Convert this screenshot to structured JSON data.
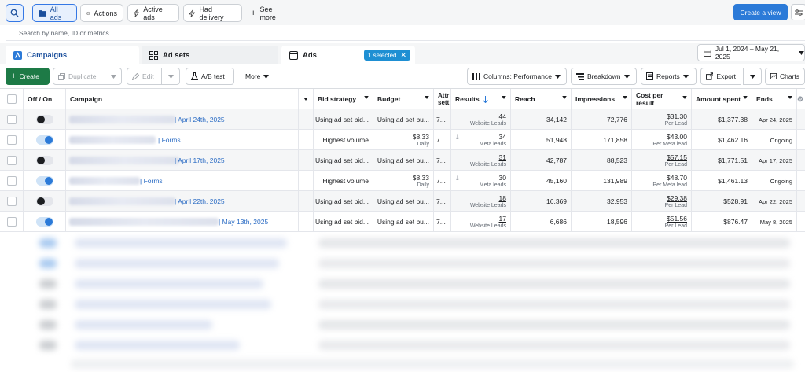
{
  "filters": {
    "all_ads": "All ads",
    "actions": "Actions",
    "active_ads": "Active ads",
    "had_delivery": "Had delivery",
    "see_more": "See more"
  },
  "create_view": "Create a view",
  "search": {
    "placeholder": "Search by name, ID or metrics"
  },
  "tabs": {
    "campaigns": "Campaigns",
    "ad_sets": "Ad sets",
    "ads": "Ads",
    "selected": "1 selected"
  },
  "date_range": "Jul 1, 2024 – May 21, 2025",
  "toolbar": {
    "create": "Create",
    "duplicate": "Duplicate",
    "edit": "Edit",
    "ab_test": "A/B test",
    "more": "More",
    "columns": "Columns: Performance",
    "breakdown": "Breakdown",
    "reports": "Reports",
    "export": "Export",
    "charts": "Charts"
  },
  "columns": {
    "off_on": "Off / On",
    "campaign": "Campaign",
    "bid_strategy": "Bid strategy",
    "budget": "Budget",
    "attribution": "Attr sett",
    "results": "Results",
    "reach": "Reach",
    "impressions": "Impressions",
    "cost_per_result_1": "Cost per",
    "cost_per_result_2": "result",
    "amount_spent": "Amount spent",
    "ends": "Ends"
  },
  "rows": [
    {
      "on": false,
      "name_suffix": "| April 24th, 2025",
      "bid": "Using ad set bid...",
      "budget": "Using ad set bu...",
      "budget_sub": "",
      "attr": "7...",
      "results": "44",
      "results_sub": "Website Leads",
      "reach": "34,142",
      "impressions": "72,776",
      "cost": "$31.30",
      "cost_sub": "Per Lead",
      "spent": "$1,377.38",
      "ends": "Apr 24, 2025"
    },
    {
      "on": true,
      "name_suffix": "| Forms",
      "bid": "Highest volume",
      "budget": "$8.33",
      "budget_sub": "Daily",
      "attr": "7...",
      "results": "34",
      "results_sub": "Meta leads",
      "reach": "51,948",
      "impressions": "171,858",
      "cost": "$43.00",
      "cost_sub": "Per Meta lead",
      "spent": "$1,462.16",
      "ends": "Ongoing"
    },
    {
      "on": false,
      "name_suffix": "| April 17th, 2025",
      "bid": "Using ad set bid...",
      "budget": "Using ad set bu...",
      "budget_sub": "",
      "attr": "7...",
      "results": "31",
      "results_sub": "Website Leads",
      "reach": "42,787",
      "impressions": "88,523",
      "cost": "$57.15",
      "cost_sub": "Per Lead",
      "spent": "$1,771.51",
      "ends": "Apr 17, 2025"
    },
    {
      "on": true,
      "name_suffix": "| Forms",
      "bid": "Highest volume",
      "budget": "$8.33",
      "budget_sub": "Daily",
      "attr": "7...",
      "results": "30",
      "results_sub": "Meta leads",
      "reach": "45,160",
      "impressions": "131,989",
      "cost": "$48.70",
      "cost_sub": "Per Meta lead",
      "spent": "$1,461.13",
      "ends": "Ongoing"
    },
    {
      "on": false,
      "name_suffix": "| April 22th, 2025",
      "bid": "Using ad set bid...",
      "budget": "Using ad set bu...",
      "budget_sub": "",
      "attr": "7...",
      "results": "18",
      "results_sub": "Website Leads",
      "reach": "16,369",
      "impressions": "32,953",
      "cost": "$29.38",
      "cost_sub": "Per Lead",
      "spent": "$528.91",
      "ends": "Apr 22, 2025"
    },
    {
      "on": true,
      "name_suffix": "| May 13th, 2025",
      "bid": "Using ad set bid...",
      "budget": "Using ad set bu...",
      "budget_sub": "",
      "attr": "7...",
      "results": "17",
      "results_sub": "Website Leads",
      "reach": "6,686",
      "impressions": "18,596",
      "cost": "$51.56",
      "cost_sub": "Per Lead",
      "spent": "$876.47",
      "ends": "May 8, 2025"
    }
  ],
  "colors": {
    "accent": "#2b7ad8",
    "create_green": "#1d7a46",
    "chip": "#1e8fd3",
    "link": "#2b6cc4"
  }
}
